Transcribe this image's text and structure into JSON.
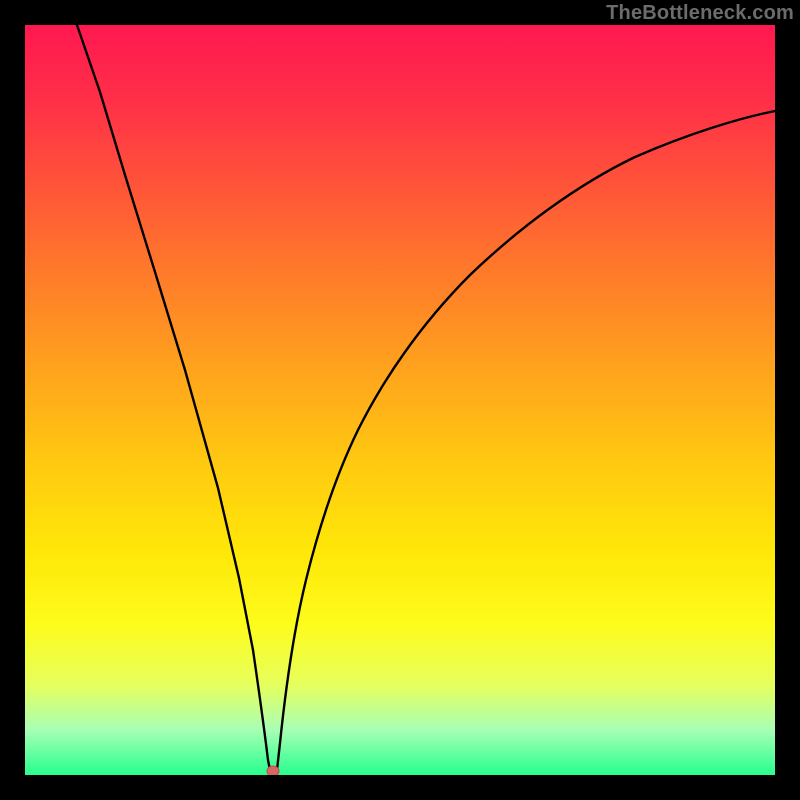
{
  "watermark": {
    "text": "TheBottleneck.com"
  },
  "chart_data": {
    "type": "line",
    "title": "",
    "xlabel": "",
    "ylabel": "",
    "xlim": [
      0,
      100
    ],
    "ylim": [
      0,
      100
    ],
    "grid": false,
    "legend": null,
    "minimum_marker": {
      "x": 33,
      "y": 0,
      "color": "#d9534f"
    },
    "series": [
      {
        "name": "bottleneck-curve",
        "color": "#000000",
        "x": [
          0,
          5,
          10,
          15,
          20,
          25,
          28,
          30,
          32,
          33,
          34,
          36,
          38,
          40,
          45,
          50,
          55,
          60,
          65,
          70,
          75,
          80,
          85,
          90,
          95,
          100
        ],
        "y": [
          100,
          85,
          70,
          55,
          40,
          24,
          14,
          8,
          3,
          0,
          4,
          12,
          20,
          28,
          42,
          53,
          61,
          67,
          72,
          76,
          79,
          81,
          83,
          84,
          85,
          86
        ]
      }
    ]
  }
}
